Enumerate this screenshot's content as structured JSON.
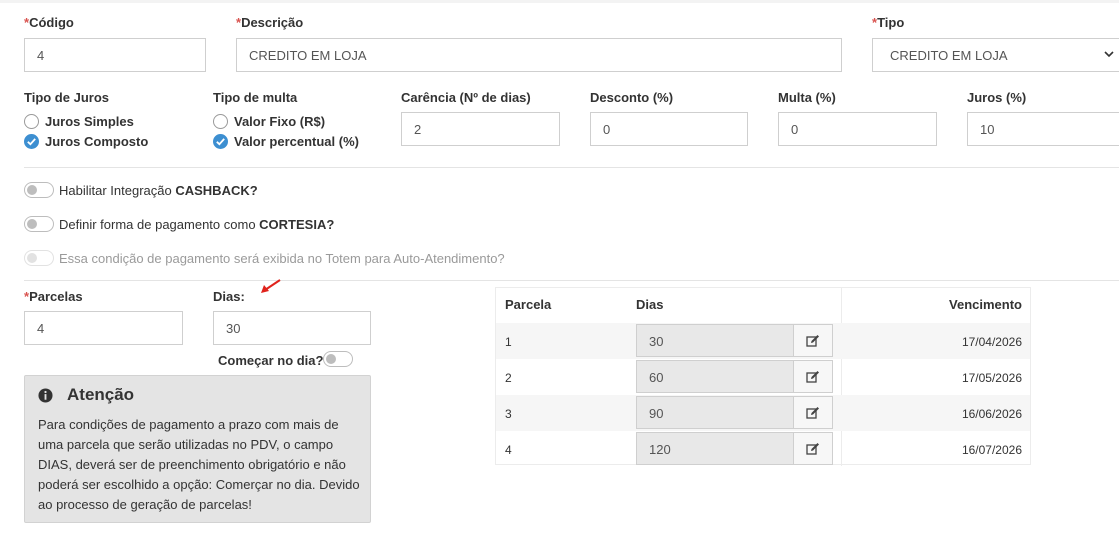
{
  "required_mark": "*",
  "codigo": {
    "label": "Código",
    "value": "4"
  },
  "descricao": {
    "label": "Descrição",
    "value": "CREDITO EM LOJA"
  },
  "tipo": {
    "label": "Tipo",
    "value": "CREDITO EM LOJA"
  },
  "tipo_juros": {
    "label": "Tipo de Juros",
    "options": [
      {
        "label": "Juros Simples",
        "checked": false
      },
      {
        "label": "Juros Composto",
        "checked": true
      }
    ]
  },
  "tipo_multa": {
    "label": "Tipo de multa",
    "options": [
      {
        "label": "Valor Fixo (R$)",
        "checked": false
      },
      {
        "label": "Valor percentual (%)",
        "checked": true
      }
    ]
  },
  "carencia": {
    "label": "Carência (Nº de dias)",
    "value": "2"
  },
  "desconto": {
    "label": "Desconto (%)",
    "value": "0"
  },
  "multa": {
    "label": "Multa (%)",
    "value": "0"
  },
  "juros": {
    "label": "Juros (%)",
    "value": "10"
  },
  "toggles": {
    "cashback": {
      "prefix": "Habilitar Integração ",
      "bold": "CASHBACK?"
    },
    "cortesia": {
      "prefix": "Definir forma de pagamento como ",
      "bold": "CORTESIA?"
    },
    "totem": {
      "text": "Essa condição de pagamento será exibida no Totem para Auto-Atendimento?"
    }
  },
  "parcelas": {
    "label": "Parcelas",
    "value": "4"
  },
  "dias": {
    "label": "Dias:",
    "value": "30"
  },
  "comecar": {
    "label": "Começar no dia?"
  },
  "alert": {
    "title": "Atenção",
    "text": "Para condições de pagamento a prazo com mais de uma parcela que serão utilizadas no PDV, o campo DIAS, deverá ser de preenchimento obrigatório e não poderá ser escolhido a opção: Comerçar no dia. Devido ao processo de geração de parcelas!"
  },
  "table": {
    "headers": [
      "Parcela",
      "Dias",
      "Vencimento"
    ],
    "rows": [
      {
        "parcela": "1",
        "dias": "30",
        "vencimento": "17/04/2026"
      },
      {
        "parcela": "2",
        "dias": "60",
        "vencimento": "17/05/2026"
      },
      {
        "parcela": "3",
        "dias": "90",
        "vencimento": "16/06/2026"
      },
      {
        "parcela": "4",
        "dias": "120",
        "vencimento": "16/07/2026"
      }
    ]
  },
  "colors": {
    "required": "#d9534f",
    "accent": "#3d8fd1",
    "arrow": "#e0231c"
  }
}
